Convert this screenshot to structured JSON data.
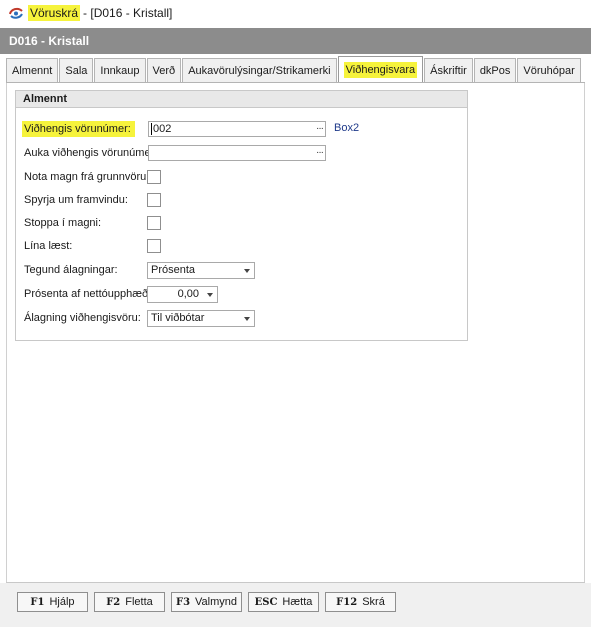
{
  "window": {
    "app_name": "Vöruskrá",
    "title_rest": "- [D016 - Kristall]"
  },
  "header": {
    "title": "D016 - Kristall"
  },
  "tabs": [
    {
      "label": "Almennt"
    },
    {
      "label": "Sala"
    },
    {
      "label": "Innkaup"
    },
    {
      "label": "Verð"
    },
    {
      "label": "Aukavörulýsingar/Strikamerki"
    },
    {
      "label": "Viðhengisvara",
      "active": true
    },
    {
      "label": "Áskriftir"
    },
    {
      "label": "dkPos"
    },
    {
      "label": "Vöruhópar"
    }
  ],
  "group": {
    "title": "Almennt",
    "fields": {
      "vidhengis_vorunumer": {
        "label": "Viðhengis vörunúmer:",
        "value": "002",
        "browse": "···",
        "lookup_text": "Box2"
      },
      "auka_vidhengis_vorunumer": {
        "label": "Auka viðhengis vörunúmer:",
        "value": "",
        "browse": "···"
      },
      "nota_magn": {
        "label": "Nota magn frá grunnvöru:",
        "checked": false
      },
      "spyrja_framvindu": {
        "label": "Spyrja um framvindu:",
        "checked": false
      },
      "stoppa_magni": {
        "label": "Stoppa í magni:",
        "checked": false
      },
      "lina_laest": {
        "label": "Lína læst:",
        "checked": false
      },
      "tegund_alagningar": {
        "label": "Tegund álagningar:",
        "selected": "Prósenta"
      },
      "prosenta_nettoupphaed": {
        "label": "Prósenta af nettóupphæð:",
        "value": "0,00"
      },
      "alagning_vidhengisvoru": {
        "label": "Álagning viðhengisvöru:",
        "selected": "Til viðbótar"
      }
    }
  },
  "footer": {
    "buttons": [
      {
        "key": "F1",
        "label": "Hjálp"
      },
      {
        "key": "F2",
        "label": "Fletta"
      },
      {
        "key": "F3",
        "label": "Valmynd"
      },
      {
        "key": "ESC",
        "label": "Hætta"
      },
      {
        "key": "F12",
        "label": "Skrá"
      }
    ]
  },
  "colors": {
    "highlight": "#f6f33c",
    "header_bg": "#8c8c8c",
    "link_text": "#1f3a8a"
  },
  "icons": {
    "app": "dk-app-icon",
    "dropdown": "chevron-down-icon",
    "browse": "ellipsis-icon"
  }
}
